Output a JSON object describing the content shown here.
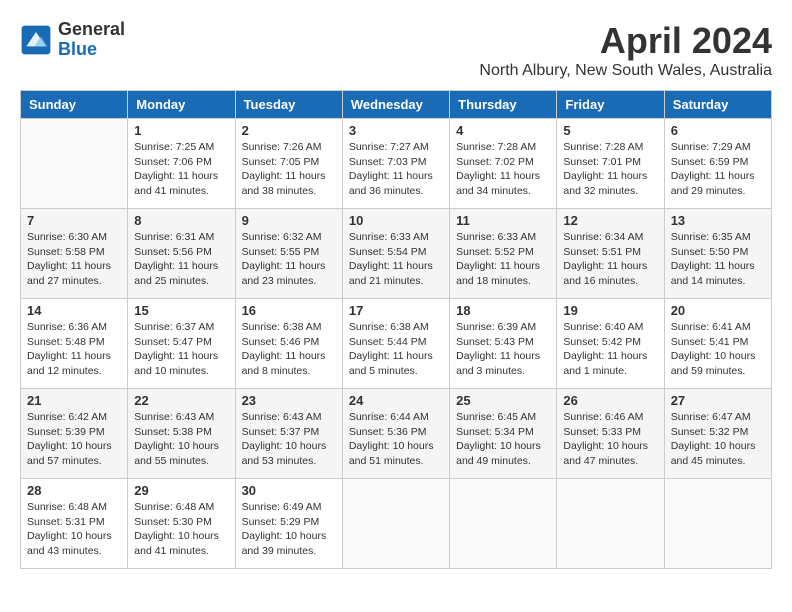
{
  "header": {
    "logo_general": "General",
    "logo_blue": "Blue",
    "month_title": "April 2024",
    "location": "North Albury, New South Wales, Australia"
  },
  "weekdays": [
    "Sunday",
    "Monday",
    "Tuesday",
    "Wednesday",
    "Thursday",
    "Friday",
    "Saturday"
  ],
  "weeks": [
    [
      {
        "day": "",
        "info": ""
      },
      {
        "day": "1",
        "info": "Sunrise: 7:25 AM\nSunset: 7:06 PM\nDaylight: 11 hours\nand 41 minutes."
      },
      {
        "day": "2",
        "info": "Sunrise: 7:26 AM\nSunset: 7:05 PM\nDaylight: 11 hours\nand 38 minutes."
      },
      {
        "day": "3",
        "info": "Sunrise: 7:27 AM\nSunset: 7:03 PM\nDaylight: 11 hours\nand 36 minutes."
      },
      {
        "day": "4",
        "info": "Sunrise: 7:28 AM\nSunset: 7:02 PM\nDaylight: 11 hours\nand 34 minutes."
      },
      {
        "day": "5",
        "info": "Sunrise: 7:28 AM\nSunset: 7:01 PM\nDaylight: 11 hours\nand 32 minutes."
      },
      {
        "day": "6",
        "info": "Sunrise: 7:29 AM\nSunset: 6:59 PM\nDaylight: 11 hours\nand 29 minutes."
      }
    ],
    [
      {
        "day": "7",
        "info": "Sunrise: 6:30 AM\nSunset: 5:58 PM\nDaylight: 11 hours\nand 27 minutes."
      },
      {
        "day": "8",
        "info": "Sunrise: 6:31 AM\nSunset: 5:56 PM\nDaylight: 11 hours\nand 25 minutes."
      },
      {
        "day": "9",
        "info": "Sunrise: 6:32 AM\nSunset: 5:55 PM\nDaylight: 11 hours\nand 23 minutes."
      },
      {
        "day": "10",
        "info": "Sunrise: 6:33 AM\nSunset: 5:54 PM\nDaylight: 11 hours\nand 21 minutes."
      },
      {
        "day": "11",
        "info": "Sunrise: 6:33 AM\nSunset: 5:52 PM\nDaylight: 11 hours\nand 18 minutes."
      },
      {
        "day": "12",
        "info": "Sunrise: 6:34 AM\nSunset: 5:51 PM\nDaylight: 11 hours\nand 16 minutes."
      },
      {
        "day": "13",
        "info": "Sunrise: 6:35 AM\nSunset: 5:50 PM\nDaylight: 11 hours\nand 14 minutes."
      }
    ],
    [
      {
        "day": "14",
        "info": "Sunrise: 6:36 AM\nSunset: 5:48 PM\nDaylight: 11 hours\nand 12 minutes."
      },
      {
        "day": "15",
        "info": "Sunrise: 6:37 AM\nSunset: 5:47 PM\nDaylight: 11 hours\nand 10 minutes."
      },
      {
        "day": "16",
        "info": "Sunrise: 6:38 AM\nSunset: 5:46 PM\nDaylight: 11 hours\nand 8 minutes."
      },
      {
        "day": "17",
        "info": "Sunrise: 6:38 AM\nSunset: 5:44 PM\nDaylight: 11 hours\nand 5 minutes."
      },
      {
        "day": "18",
        "info": "Sunrise: 6:39 AM\nSunset: 5:43 PM\nDaylight: 11 hours\nand 3 minutes."
      },
      {
        "day": "19",
        "info": "Sunrise: 6:40 AM\nSunset: 5:42 PM\nDaylight: 11 hours\nand 1 minute."
      },
      {
        "day": "20",
        "info": "Sunrise: 6:41 AM\nSunset: 5:41 PM\nDaylight: 10 hours\nand 59 minutes."
      }
    ],
    [
      {
        "day": "21",
        "info": "Sunrise: 6:42 AM\nSunset: 5:39 PM\nDaylight: 10 hours\nand 57 minutes."
      },
      {
        "day": "22",
        "info": "Sunrise: 6:43 AM\nSunset: 5:38 PM\nDaylight: 10 hours\nand 55 minutes."
      },
      {
        "day": "23",
        "info": "Sunrise: 6:43 AM\nSunset: 5:37 PM\nDaylight: 10 hours\nand 53 minutes."
      },
      {
        "day": "24",
        "info": "Sunrise: 6:44 AM\nSunset: 5:36 PM\nDaylight: 10 hours\nand 51 minutes."
      },
      {
        "day": "25",
        "info": "Sunrise: 6:45 AM\nSunset: 5:34 PM\nDaylight: 10 hours\nand 49 minutes."
      },
      {
        "day": "26",
        "info": "Sunrise: 6:46 AM\nSunset: 5:33 PM\nDaylight: 10 hours\nand 47 minutes."
      },
      {
        "day": "27",
        "info": "Sunrise: 6:47 AM\nSunset: 5:32 PM\nDaylight: 10 hours\nand 45 minutes."
      }
    ],
    [
      {
        "day": "28",
        "info": "Sunrise: 6:48 AM\nSunset: 5:31 PM\nDaylight: 10 hours\nand 43 minutes."
      },
      {
        "day": "29",
        "info": "Sunrise: 6:48 AM\nSunset: 5:30 PM\nDaylight: 10 hours\nand 41 minutes."
      },
      {
        "day": "30",
        "info": "Sunrise: 6:49 AM\nSunset: 5:29 PM\nDaylight: 10 hours\nand 39 minutes."
      },
      {
        "day": "",
        "info": ""
      },
      {
        "day": "",
        "info": ""
      },
      {
        "day": "",
        "info": ""
      },
      {
        "day": "",
        "info": ""
      }
    ]
  ]
}
